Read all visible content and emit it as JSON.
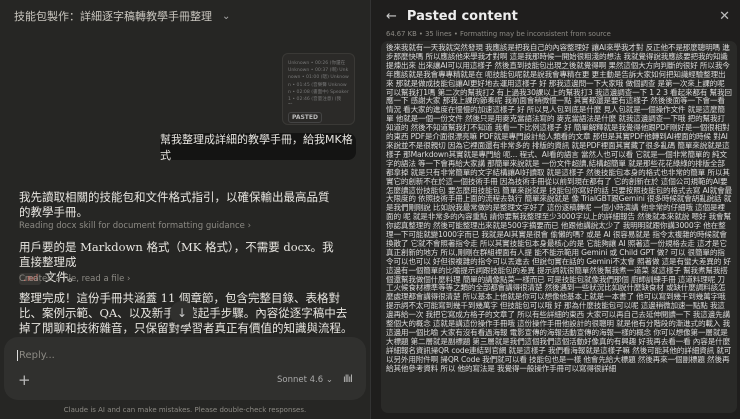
{
  "left": {
    "title": "技能包製作：詳細逐字稿轉教學手冊整理",
    "pasted_card": {
      "preview": "Unknown • 00:26 (你還在 Unknown • 00:37 (啊) Unknown • 01:00 (嗯) Unknown • 01:45 (音樂聲 Unknown • 02:08 (書面中) Speaker 1 • 02:46 (音量注意) (我聽…",
      "badge": "PASTED"
    },
    "user_message": "幫我整理成詳細的教學手冊，給我MK格式",
    "assistant": {
      "msg1": "我先讀取相關的技能包和文件格式指引，以確保輸出最高品質的教學手冊。",
      "tool1": "Reading docx skill for document formatting guidance",
      "msg2_a": "用戶要的是 Markdown 格式（MK 格式），不需要 docx。我直接整理成",
      "msg2_code": ".md",
      "msg2_b": "文件。",
      "tool2": "Created a file, read a file",
      "msg3": "整理完成！這份手冊共涵蓋 11 個章節，包含完整目錄、表格對比、案例示範、QA、以及新手快速起手步驟。內容從逐字稿中去掉了閒聊和技術雜音，只保留對學習者真正有價值的知識與流程。"
    },
    "input": {
      "placeholder": "Reply...",
      "model": "Sonnet 4.6"
    },
    "footer": "Claude is AI and can make mistakes. Please double-check responses."
  },
  "right": {
    "title": "Pasted content",
    "meta": "64.67 KB  •  35 lines  •  Formatting may be inconsistent from source",
    "content": "後來我就有一天我就突然發現 我應該是把我自己的內容整理好 讓AI來學我才對 反正他不是那麼聰明嗎 進步那麼快嗎 所以應該他來學我才對啊 這是我那時候一開始很粗淺的想法 我就覺得說我應該要把我的知識提煉出來 出來讓AI可以用這樣子 然後直到技能包出現之後就覺得啊 果然這個大方向判斷的很好 所以我今年應該就是我會專專精就是在 呃技能包呢就是說我會專精在更 更主動是告訴大家如何把知識經驗整理出來 那就是做成技能包讓AI更好地去運用這樣子 好 那我這邊問一下大家哦 做個調查 是第一次來上課的呢 可以幫我打1嗎 第二次的幫我打2 有上過我30課以上的幫我打3 我這邊調查一下 1 2 3 看起來都有 幫我回應一下 感謝大家 那我上課的節奏呢 我前面會稍微慢一點 其實都還是要有這樣子 然後後面等一下會一看情況 看大家的進度在慢慢的加速這樣子 好 所以見人包到底是什麼 見人包就是一個操作文件 就是這麼簡單 他就是一個一份文件 然後只是用麥克當語法寫的 麥克當語法是什麼 就我這邊調查一下哦 把的幫我打知道的 然後不知道幫我打不知道 我看一下比例這樣子 好 簡單解釋就是我覺得他跟PDF剛好是一個很相對的東西 PDF是介面很漂亮嘛 PDF就是專門設計給人類看的文章 那但是其實PDF他轉到AI裡面的時候 對AI來說並不是很親切 因為它裡面還有非常多的 排版的資訊 就是PDF裡面其實藏了很多亂碼 簡單來說就是這樣子 那Markdown其實就是專門給 呃... 程式、AI看的語言 當然人也可以看 它就是一個非常簡單的 純文字的語法 等一下會再給大家講 那簡單來說就是 一份文件超讀,結構超簡單 就是那些花花綠綠的排版全部都拿掉 就是只有非常簡單的文字結構讓AI好讀取 就是這樣子 然後技能包本身的格式也非常的簡單 所以其實它的創新不在於這一個技術手冊 因為技術手冊從以前到現在都有了 它的創新在於 這個公司規範的AI要怎麼讀這份技能包 要怎麼用技能包 簡單來說就是 技能包你寫好的話 只要按照技能包的格式去寫 AI就會最大限度的 依照技術手冊上面的流程去執行 簡單來說就是 像 TrialGBT跟Gemini 很多時候就會胡亂說話 就是我們剛剛說 比如說我最常做的是整理文字好了 這份逐稿轉呢 一個小時演講 他非常的仔細哦 這個是裡面的 呢 就是非常多的內容重點 請你要幫我整理至少3000字以上的詳細報告 然後就本來就說 嗯好 我會幫你認真整理的 然後可能整理出來就是500字摘要而已 他跟他講說太少了 我明明就跟你講3000字 他在整理一下可能就變1000字而已 我就是AI其實是很會 偷懶的嗎? 或是 AI 很容易就是 指令太複雜的時候就會換散了 它就不會照著指令走 所以其實技能包本身最核心的是 它能夠讓 AI 照著這一份規格去走 這才是它真正創新的地方 所以,剛剛在群組裡面有人提 能不能示範用 Gemini 或 Child GPT 做? 可以 很簡單的指令可以也可以 好但很複雜的指令可以丟進去 但說句實在話的 Gemini不太會 照著做 這是有蠻大差異的 好這邊有一個簡單的比喻提示詞跟技能包的差異 提示詞就很簡單然後幫我煮一道菜 就這樣子 幫我煮幫我搭個還幫我做個什麼料理 簡單的講像點菜一樣而已 可是技能包就像我們那個 廚師訓練手冊 這道料理呢 刀工火候食材標準等等之類的全部都會講得很清楚 然後遇到一些狀況比如說什麼缺食材 或缺什麼調料該怎麼處理都會講得很清楚 所以基本上他就是你可以想像他基本上就是一本書了 他可以寫到幾千到幾萬字哦 提示詞不太可能寫到幾千到幾萬字 但技能包可以哦 好 那為什麼技能包可以呢 這邊稍微加速一點點 我這邊再給一次 我把它寫成方格子的文章了 所以有些詳細的東西 大家可以再自己去延伸閱讀一下 我這邊先講整個大的概念 這就是講這份操作手冊哦 這份操作手冊他設計的很聰明 就是他有分階段的漸進式的載入 我這邊用一個比喻 大家有沒有看過海報 電影宣傳的海報活動宣傳的海報一樣的概念 你可以想像第一層就是大標題 第二層就是副標題 第三層就是我們這個我們這個活動好像真的有興趣 好我再去看一看 內容是什麼 詳細報名資訊掃QR code連結到官網 就是這樣子 我們看海報就是這樣子嘛 然後可能其他的詳細資訊 就可以另外用附件啊 掃QR Code 我們就可以看 技能包也是一樣 他會先給大標題 然後再來一個副標題 然後再給其他參考資料 所以 他的寫法是 我覺得一般操作手冊可以寫得很詳細"
  },
  "colors": {
    "bg_left": "#262624",
    "bg_right": "#1f1e1d",
    "code": "#e07a6e"
  }
}
